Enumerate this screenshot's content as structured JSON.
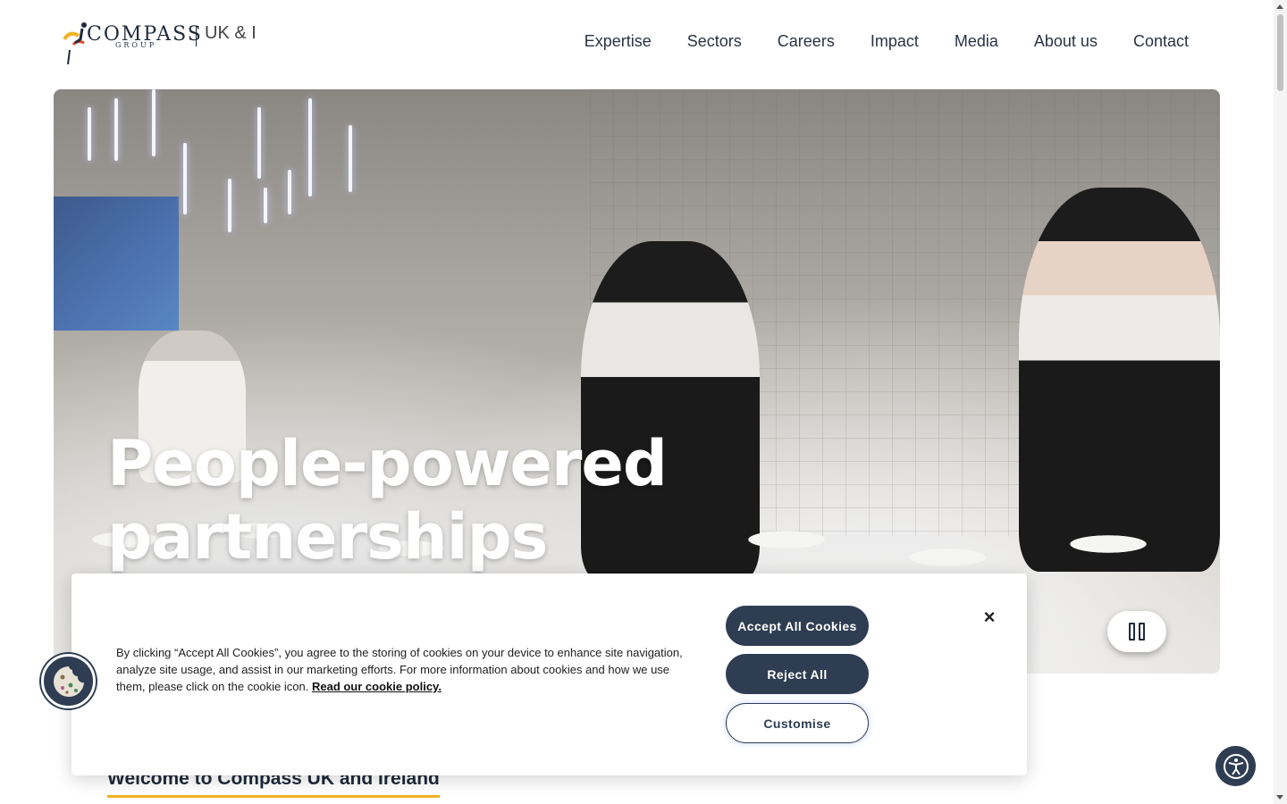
{
  "brand": {
    "name": "COMPASS",
    "group": "GROUP",
    "region": "UK & I"
  },
  "nav": {
    "items": [
      "Expertise",
      "Sectors",
      "Careers",
      "Impact",
      "Media",
      "About us",
      "Contact"
    ]
  },
  "hero": {
    "title_line1": "People-powered",
    "title_line2": "partnerships"
  },
  "welcome": {
    "heading": "Welcome to Compass UK and Ireland"
  },
  "cookie_banner": {
    "body": "By clicking “Accept All Cookies”, you agree to the storing of cookies on your device to enhance site navigation, analyze site usage, and assist in our marketing efforts. For more information about cookies and how we use them, please click on the cookie icon.",
    "policy_link": "Read our cookie policy.",
    "accept_label": "Accept All Cookies",
    "reject_label": "Reject All",
    "customise_label": "Customise",
    "close_glyph": "×"
  },
  "colors": {
    "navy": "#2f3d52",
    "accent_underline": "#f0b323"
  },
  "icons": [
    "compass-logo-icon",
    "pause-icon",
    "close-icon",
    "cookie-icon",
    "accessibility-icon"
  ]
}
